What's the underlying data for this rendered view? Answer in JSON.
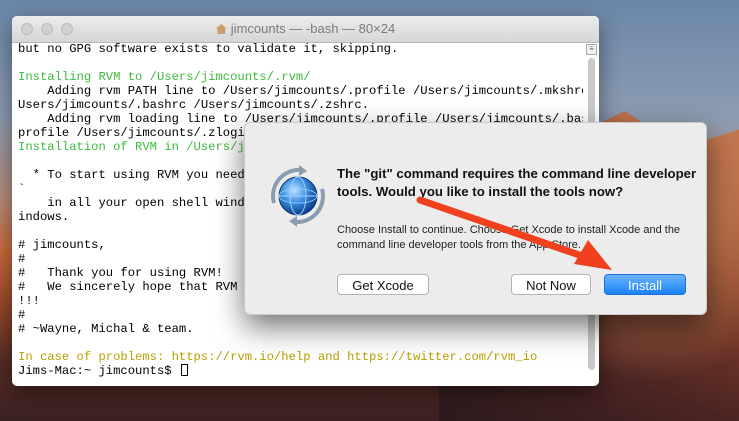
{
  "terminal": {
    "title": "jimcounts — -bash — 80×24",
    "lines": [
      {
        "text": "but no GPG software exists to validate it, skipping.",
        "c": ""
      },
      {
        "text": "",
        "c": ""
      },
      {
        "text": "Installing RVM to /Users/jimcounts/.rvm/",
        "c": "g"
      },
      {
        "text": "    Adding rvm PATH line to /Users/jimcounts/.profile /Users/jimcounts/.mkshrc /",
        "c": ""
      },
      {
        "text": "Users/jimcounts/.bashrc /Users/jimcounts/.zshrc.",
        "c": ""
      },
      {
        "text": "    Adding rvm loading line to /Users/jimcounts/.profile /Users/jimcounts/.bash",
        "c": ""
      },
      {
        "text": "profile /Users/jimcounts/.zlogin",
        "c": ""
      },
      {
        "text": "Installation of RVM in /Users/jim",
        "c": "g"
      },
      {
        "text": "",
        "c": ""
      },
      {
        "text": "  * To start using RVM you need t",
        "c": ""
      },
      {
        "text": "`",
        "c": ""
      },
      {
        "text": "    in all your open shell window",
        "c": ""
      },
      {
        "text": "indows.",
        "c": ""
      },
      {
        "text": "",
        "c": ""
      },
      {
        "text": "# jimcounts,",
        "c": ""
      },
      {
        "text": "#",
        "c": ""
      },
      {
        "text": "#   Thank you for using RVM!",
        "c": ""
      },
      {
        "text": "#   We sincerely hope that RVM he",
        "c": ""
      },
      {
        "text": "!!!",
        "c": ""
      },
      {
        "text": "#",
        "c": ""
      },
      {
        "text": "# ~Wayne, Michal & team.",
        "c": ""
      },
      {
        "text": "",
        "c": ""
      },
      {
        "text": "In case of problems: https://rvm.io/help and https://twitter.com/rvm_io",
        "c": "y"
      }
    ],
    "prompt": "Jims-Mac:~ jimcounts$ "
  },
  "dialog": {
    "title": "The \"git\" command requires the command line developer tools. Would you like to install the tools now?",
    "text": "Choose Install to continue. Choose Get Xcode to install Xcode and the command line developer tools from the App Store.",
    "buttons": {
      "get_xcode": "Get Xcode",
      "not_now": "Not Now",
      "install": "Install"
    }
  },
  "colors": {
    "accent": "#1a82fb",
    "arrow": "#f0401e",
    "terminal_green": "#3cba3c"
  }
}
